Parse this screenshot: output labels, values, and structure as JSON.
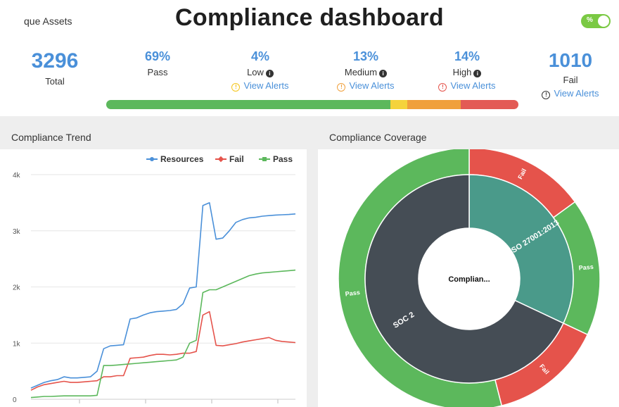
{
  "header": {
    "left_label": "que Assets",
    "title": "Compliance dashboard",
    "toggle_label": "%"
  },
  "summary": {
    "total": {
      "value": "3296",
      "label": "Total"
    },
    "pass": {
      "value": "69%",
      "label": "Pass"
    },
    "low": {
      "value": "4%",
      "label": "Low",
      "alerts": "View Alerts"
    },
    "medium": {
      "value": "13%",
      "label": "Medium",
      "alerts": "View Alerts"
    },
    "high": {
      "value": "14%",
      "label": "High",
      "alerts": "View Alerts"
    },
    "fail": {
      "value": "1010",
      "label": "Fail",
      "alerts": "View Alerts"
    }
  },
  "severity_bar": [
    {
      "name": "pass",
      "fraction": 0.69,
      "color": "#5cb85c"
    },
    {
      "name": "low",
      "fraction": 0.04,
      "color": "#f5d33c"
    },
    {
      "name": "medium",
      "fraction": 0.13,
      "color": "#f0a03c"
    },
    {
      "name": "high",
      "fraction": 0.14,
      "color": "#e35a55"
    }
  ],
  "colors": {
    "resources": "#4a90d9",
    "fail": "#e5534b",
    "pass": "#5cb85c",
    "dark": "#454d55",
    "teal": "#4a9a8a"
  },
  "panels": {
    "trend_title": "Compliance Trend",
    "coverage_title": "Compliance Coverage"
  },
  "legend": {
    "resources": "Resources",
    "fail": "Fail",
    "pass": "Pass"
  },
  "chart_data": {
    "type": "line",
    "ylim": [
      0,
      4000
    ],
    "yticks": [
      "0",
      "1k",
      "2k",
      "3k",
      "4k"
    ],
    "x": [
      0,
      1,
      2,
      3,
      4,
      5,
      6,
      7,
      8,
      9,
      10,
      11,
      12,
      13,
      14,
      15,
      16,
      17,
      18,
      19,
      20,
      21,
      22,
      23,
      24,
      25,
      26,
      27,
      28,
      29,
      30,
      31,
      32,
      33,
      34,
      35,
      36,
      37,
      38,
      39,
      40
    ],
    "series": [
      {
        "name": "Resources",
        "color": "#4a90d9",
        "values": [
          200,
          250,
          300,
          330,
          350,
          400,
          380,
          380,
          390,
          400,
          500,
          900,
          950,
          960,
          970,
          1430,
          1450,
          1500,
          1540,
          1560,
          1570,
          1580,
          1600,
          1700,
          1980,
          2000,
          3450,
          3500,
          2850,
          2870,
          3000,
          3150,
          3200,
          3230,
          3240,
          3260,
          3270,
          3280,
          3285,
          3290,
          3300
        ]
      },
      {
        "name": "Fail",
        "color": "#e5534b",
        "values": [
          160,
          220,
          260,
          280,
          300,
          320,
          300,
          300,
          310,
          320,
          330,
          400,
          400,
          420,
          420,
          730,
          740,
          750,
          780,
          800,
          800,
          790,
          800,
          820,
          820,
          850,
          1500,
          1560,
          960,
          950,
          970,
          990,
          1020,
          1040,
          1060,
          1080,
          1100,
          1050,
          1030,
          1020,
          1010
        ]
      },
      {
        "name": "Pass",
        "color": "#5cb85c",
        "values": [
          30,
          40,
          50,
          50,
          55,
          60,
          60,
          60,
          60,
          60,
          70,
          600,
          600,
          610,
          620,
          630,
          640,
          650,
          660,
          670,
          680,
          690,
          700,
          750,
          1000,
          1050,
          1900,
          1950,
          1950,
          2000,
          2050,
          2100,
          2150,
          2200,
          2230,
          2250,
          2260,
          2270,
          2280,
          2290,
          2300
        ]
      }
    ]
  },
  "coverage": {
    "center_label": "Complian...",
    "inner": [
      {
        "label": "ISO 27001:2013",
        "value": 32,
        "color": "#4a9a8a"
      },
      {
        "label": "SOC 2",
        "value": 68,
        "color": "#454d55"
      }
    ],
    "outer": [
      {
        "label": "Fail",
        "value": 15,
        "color": "#e5534b"
      },
      {
        "label": "Pass",
        "value": 17,
        "color": "#5cb85c"
      },
      {
        "label": "Fail",
        "value": 14,
        "color": "#e5534b"
      },
      {
        "label": "Pass",
        "value": 54,
        "color": "#5cb85c"
      }
    ]
  }
}
